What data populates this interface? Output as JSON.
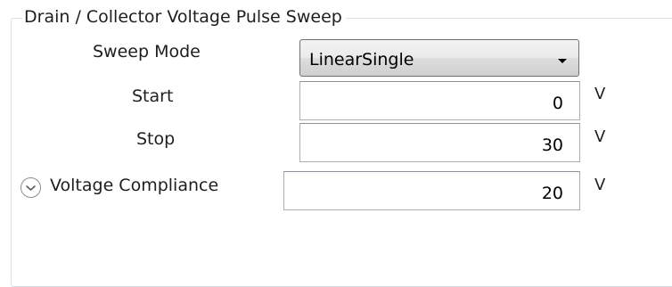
{
  "group": {
    "title": "Drain / Collector Voltage Pulse Sweep"
  },
  "sweep_mode": {
    "label": "Sweep Mode",
    "value": "LinearSingle"
  },
  "start": {
    "label": "Start",
    "value": "0",
    "unit": "V"
  },
  "stop": {
    "label": "Stop",
    "value": "30",
    "unit": "V"
  },
  "compliance": {
    "label": "Voltage Compliance",
    "value": "20",
    "unit": "V",
    "expander_icon": "chevron-down-circle-icon"
  }
}
